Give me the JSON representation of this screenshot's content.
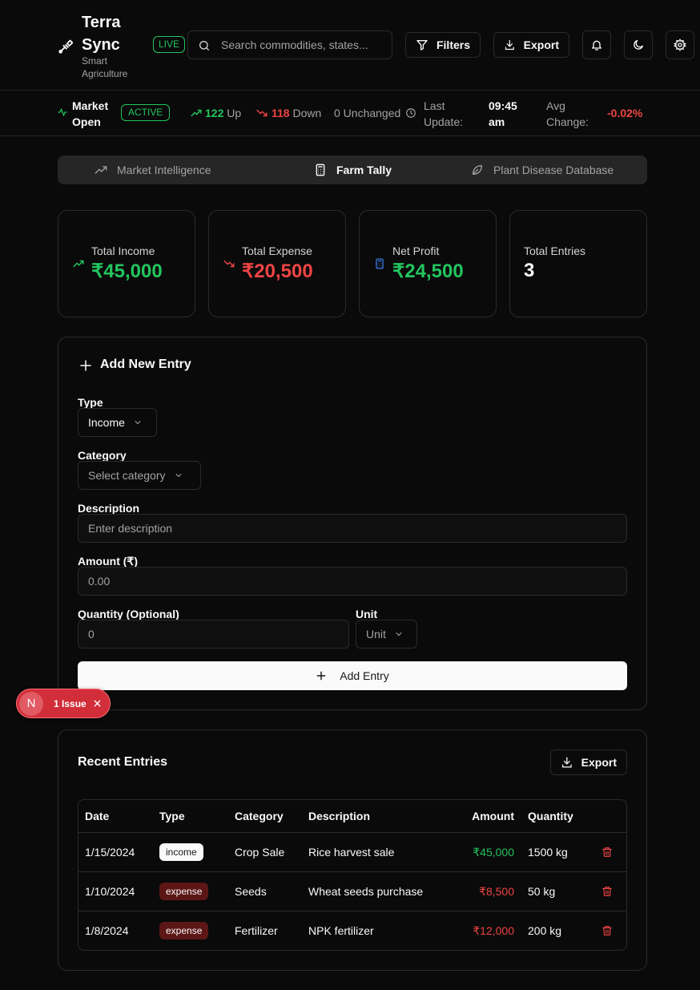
{
  "header": {
    "brand_name": "Terra Sync",
    "brand_subtitle": "Smart Agriculture",
    "live_label": "LIVE",
    "search_placeholder": "Search commodities, states...",
    "filters_label": "Filters",
    "export_label": "Export"
  },
  "status": {
    "market_label": "Market Open",
    "market_state": "ACTIVE",
    "up_count": "122",
    "up_label": "Up",
    "down_count": "118",
    "down_label": "Down",
    "unchanged_label": "0 Unchanged",
    "last_update_label": "Last Update:",
    "last_update_value": "09:45 am",
    "avg_change_label": "Avg Change:",
    "avg_change_value": "-0.02%"
  },
  "tabs": [
    {
      "label": "Market Intelligence",
      "icon": "trending-up-icon",
      "active": false
    },
    {
      "label": "Farm Tally",
      "icon": "calculator-icon",
      "active": true
    },
    {
      "label": "Plant Disease Database",
      "icon": "leaf-icon",
      "active": false
    }
  ],
  "stats": {
    "income_label": "Total Income",
    "income_value": "₹45,000",
    "expense_label": "Total Expense",
    "expense_value": "₹20,500",
    "profit_label": "Net Profit",
    "profit_value": "₹24,500",
    "entries_label": "Total Entries",
    "entries_value": "3"
  },
  "form": {
    "title": "Add New Entry",
    "type_label": "Type",
    "type_value": "Income",
    "category_label": "Category",
    "category_placeholder": "Select category",
    "description_label": "Description",
    "description_placeholder": "Enter description",
    "amount_label": "Amount (₹)",
    "amount_placeholder": "0.00",
    "quantity_label": "Quantity (Optional)",
    "quantity_placeholder": "0",
    "unit_label": "Unit",
    "unit_placeholder": "Unit",
    "submit_label": "Add Entry"
  },
  "issue": {
    "avatar_letter": "N",
    "label": "1 Issue"
  },
  "recent": {
    "title": "Recent Entries",
    "export_label": "Export",
    "columns": [
      "Date",
      "Type",
      "Category",
      "Description",
      "Amount",
      "Quantity"
    ],
    "rows": [
      {
        "date": "1/15/2024",
        "type": "income",
        "category": "Crop Sale",
        "description": "Rice harvest sale",
        "amount": "₹45,000",
        "quantity": "1500 kg"
      },
      {
        "date": "1/10/2024",
        "type": "expense",
        "category": "Seeds",
        "description": "Wheat seeds purchase",
        "amount": "₹8,500",
        "quantity": "50 kg"
      },
      {
        "date": "1/8/2024",
        "type": "expense",
        "category": "Fertilizer",
        "description": "NPK fertilizer",
        "amount": "₹12,000",
        "quantity": "200 kg"
      }
    ]
  },
  "colors": {
    "positive": "#22c55e",
    "negative": "#ef4444",
    "accent_blue": "#3b82f6",
    "background": "#0a0a0a"
  }
}
